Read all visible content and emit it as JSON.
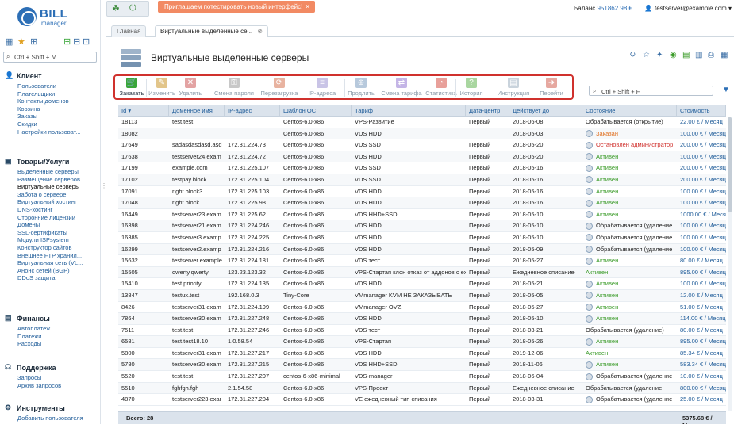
{
  "app": {
    "logo_bill": "BILL",
    "logo_manager": "manager"
  },
  "sidebar": {
    "search_placeholder": "Ctrl + Shift + M",
    "groups": [
      {
        "title": "Клиент",
        "icon": "user-icon",
        "items": [
          "Пользователи",
          "Плательщики",
          "Контакты доменов",
          "Корзина",
          "Заказы",
          "Скидки",
          "Настройки пользоват..."
        ]
      },
      {
        "title": "Товары/Услуги",
        "icon": "box-icon",
        "items": [
          "Выделенные серверы",
          "Размещение серверов",
          "Виртуальные серверы",
          "Забота о сервере",
          "Виртуальный хостинг",
          "DNS-хостинг",
          "Сторонние лицензии",
          "Домены",
          "SSL-сертификаты",
          "Модули ISPsystem",
          "Конструктор сайтов",
          "Внешнее FTP хранил...",
          "Виртуальная сеть (VL...",
          "Анонс сетей (BGP)",
          "DDoS защита"
        ]
      },
      {
        "title": "Финансы",
        "icon": "wallet-icon",
        "items": [
          "Автоплатеж",
          "Платежи",
          "Расходы"
        ]
      },
      {
        "title": "Поддержка",
        "icon": "headset-icon",
        "items": [
          "Запросы",
          "Архив запросов"
        ]
      },
      {
        "title": "Инструменты",
        "icon": "tools-icon",
        "items": [
          "Добавить пользователя"
        ]
      }
    ],
    "active_item": "Виртуальные серверы"
  },
  "header": {
    "promo_text": "Приглашаем потестировать новый интерфейс!",
    "balance_label": "Баланс",
    "balance_value": "951862.98 €",
    "user": "testserver@example.com"
  },
  "tabs": [
    {
      "label": "Главная",
      "active": false
    },
    {
      "label": "Виртуальные выделенные се...",
      "active": true
    }
  ],
  "page": {
    "title": "Виртуальные выделенные серверы"
  },
  "toolbar": {
    "buttons": [
      {
        "label": "Заказать",
        "icon": "order-icon",
        "enabled": true,
        "color": "#3aa63a"
      },
      {
        "label": "Изменить",
        "icon": "edit-icon",
        "enabled": false,
        "color": "#e2c58a"
      },
      {
        "label": "Удалить",
        "icon": "delete-icon",
        "enabled": false,
        "color": "#e3a3a3"
      },
      {
        "label": "Смена пароля",
        "icon": "key-icon",
        "enabled": false,
        "color": "#c8c8c8"
      },
      {
        "label": "Перезагрузка",
        "icon": "reboot-icon",
        "enabled": false,
        "color": "#e8b3a0"
      },
      {
        "label": "IP-адреса",
        "icon": "ip-icon",
        "enabled": false,
        "color": "#c9c4e6"
      },
      {
        "label": "Продлить",
        "icon": "prolong-icon",
        "enabled": false,
        "color": "#b7c9dc"
      },
      {
        "label": "Смена тарифа",
        "icon": "tariff-icon",
        "enabled": false,
        "color": "#c4b5e6"
      },
      {
        "label": "Статистика",
        "icon": "stats-icon",
        "enabled": false,
        "color": "#e8a09a"
      },
      {
        "label": "История",
        "icon": "history-icon",
        "enabled": false,
        "color": "#a9d6a0"
      },
      {
        "label": "Инструкция",
        "icon": "instruction-icon",
        "enabled": false,
        "color": "#c9d3dc"
      },
      {
        "label": "Перейти",
        "icon": "goto-icon",
        "enabled": false,
        "color": "#e6a8a0"
      }
    ]
  },
  "filter": {
    "placeholder": "Ctrl + Shift + F"
  },
  "table": {
    "columns": [
      "Id",
      "Доменное имя",
      "IP-адрес",
      "Шаблон ОС",
      "Тариф",
      "Дата-центр",
      "Действует до",
      "Состояние",
      "Стоимость"
    ],
    "rows": [
      {
        "id": "18113",
        "domain": "test.test",
        "ip": "",
        "os": "Centos-6.0-x86",
        "tariff": "VPS-Развитие",
        "dc": "Первый",
        "until": "2018-06-08",
        "state": "Обрабатывается (открытие)",
        "state_type": "processing",
        "icon": false,
        "cost": "22.00 € / Месяц"
      },
      {
        "id": "18082",
        "domain": "",
        "ip": "",
        "os": "Centos-6.0-x86",
        "tariff": "VDS HDD",
        "dc": "",
        "until": "2018-05-03",
        "state": "Заказан",
        "state_type": "ordered",
        "icon": true,
        "cost": "100.00 € / Месяц"
      },
      {
        "id": "17649",
        "domain": "sadasdasdasd.asd",
        "ip": "172.31.224.73",
        "os": "Centos-6.0-x86",
        "tariff": "VDS SSD",
        "dc": "Первый",
        "until": "2018-05-20",
        "state": "Остановлен администратор",
        "state_type": "stopped",
        "icon": true,
        "cost": "200.00 € / Месяц"
      },
      {
        "id": "17638",
        "domain": "testserver24.exam",
        "ip": "172.31.224.72",
        "os": "Centos-6.0-x86",
        "tariff": "VDS HDD",
        "dc": "Первый",
        "until": "2018-05-20",
        "state": "Активен",
        "state_type": "active",
        "icon": true,
        "cost": "100.00 € / Месяц"
      },
      {
        "id": "17199",
        "domain": "example.com",
        "ip": "172.31.225.107",
        "os": "Centos-6.0-x86",
        "tariff": "VDS SSD",
        "dc": "Первый",
        "until": "2018-05-16",
        "state": "Активен",
        "state_type": "active",
        "icon": true,
        "cost": "200.00 € / Месяц"
      },
      {
        "id": "17102",
        "domain": "testpay.block",
        "ip": "172.31.225.104",
        "os": "Centos-6.0-x86",
        "tariff": "VDS SSD",
        "dc": "Первый",
        "until": "2018-05-16",
        "state": "Активен",
        "state_type": "active",
        "icon": true,
        "cost": "200.00 € / Месяц"
      },
      {
        "id": "17091",
        "domain": "right.block3",
        "ip": "172.31.225.103",
        "os": "Centos-6.0-x86",
        "tariff": "VDS HDD",
        "dc": "Первый",
        "until": "2018-05-16",
        "state": "Активен",
        "state_type": "active",
        "icon": true,
        "cost": "100.00 € / Месяц"
      },
      {
        "id": "17048",
        "domain": "right.block",
        "ip": "172.31.225.98",
        "os": "Centos-6.0-x86",
        "tariff": "VDS HDD",
        "dc": "Первый",
        "until": "2018-05-16",
        "state": "Активен",
        "state_type": "active",
        "icon": true,
        "cost": "100.00 € / Месяц"
      },
      {
        "id": "16449",
        "domain": "testserver23.exam",
        "ip": "172.31.225.62",
        "os": "Centos-6.0-x86",
        "tariff": "VDS HHD+SSD",
        "dc": "Первый",
        "until": "2018-05-10",
        "state": "Активен",
        "state_type": "active",
        "icon": true,
        "cost": "1000.00 € / Месяц"
      },
      {
        "id": "16398",
        "domain": "testserver21.exam",
        "ip": "172.31.224.246",
        "os": "Centos-6.0-x86",
        "tariff": "VDS HDD",
        "dc": "Первый",
        "until": "2018-05-10",
        "state": "Обрабатывается (удаление",
        "state_type": "processing",
        "icon": true,
        "cost": "100.00 € / Месяц"
      },
      {
        "id": "16385",
        "domain": "testserver3.examp",
        "ip": "172.31.224.225",
        "os": "Centos-6.0-x86",
        "tariff": "VDS HDD",
        "dc": "Первый",
        "until": "2018-05-10",
        "state": "Обрабатывается (удаление",
        "state_type": "processing",
        "icon": true,
        "cost": "100.00 € / Месяц"
      },
      {
        "id": "16299",
        "domain": "testserver2.examp",
        "ip": "172.31.224.216",
        "os": "Centos-6.0-x86",
        "tariff": "VDS HDD",
        "dc": "Первый",
        "until": "2018-05-09",
        "state": "Обрабатывается (удаление",
        "state_type": "processing",
        "icon": true,
        "cost": "100.00 € / Месяц"
      },
      {
        "id": "15632",
        "domain": "testserver.example",
        "ip": "172.31.224.181",
        "os": "Centos-6.0-x86",
        "tariff": "VDS тест",
        "dc": "Первый",
        "until": "2018-05-27",
        "state": "Активен",
        "state_type": "active",
        "icon": true,
        "cost": "80.00 € / Месяц"
      },
      {
        "id": "15505",
        "domain": "qwerty.qwerty",
        "ip": "123.23.123.32",
        "os": "Centos-6.0-x86",
        "tariff": "VPS-Стартап клон отказ от аддонов с ex",
        "dc": "Первый",
        "until": "Ежедневное списание",
        "state": "Активен",
        "state_type": "active",
        "icon": false,
        "cost": "895.00 € / Месяц"
      },
      {
        "id": "15410",
        "domain": "test.priority",
        "ip": "172.31.224.135",
        "os": "Centos-6.0-x86",
        "tariff": "VDS HDD",
        "dc": "Первый",
        "until": "2018-05-21",
        "state": "Активен",
        "state_type": "active",
        "icon": true,
        "cost": "100.00 € / Месяц"
      },
      {
        "id": "13847",
        "domain": "testux.test",
        "ip": "192.168.0.3",
        "os": "Tiny-Core",
        "tariff": "VMmanager KVM НЕ ЗАКАЗЫВАТЬ",
        "dc": "Первый",
        "until": "2018-05-05",
        "state": "Активен",
        "state_type": "active",
        "icon": true,
        "cost": "12.00 € / Месяц"
      },
      {
        "id": "8426",
        "domain": "testserver31.exam",
        "ip": "172.31.224.199",
        "os": "Centos-6.0-x86",
        "tariff": "VMmanager OVZ",
        "dc": "Первый",
        "until": "2018-05-27",
        "state": "Активен",
        "state_type": "active",
        "icon": true,
        "cost": "51.00 € / Месяц"
      },
      {
        "id": "7864",
        "domain": "testserver30.exam",
        "ip": "172.31.227.248",
        "os": "Centos-6.0-x86",
        "tariff": "VDS HDD",
        "dc": "Первый",
        "until": "2018-05-10",
        "state": "Активен",
        "state_type": "active",
        "icon": true,
        "cost": "114.00 € / Месяц"
      },
      {
        "id": "7511",
        "domain": "test.test",
        "ip": "172.31.227.246",
        "os": "Centos-6.0-x86",
        "tariff": "VDS тест",
        "dc": "Первый",
        "until": "2018-03-21",
        "state": "Обрабатывается (удаление)",
        "state_type": "processing",
        "icon": false,
        "cost": "80.00 € / Месяц"
      },
      {
        "id": "6581",
        "domain": "test.test18.10",
        "ip": "1.0.58.54",
        "os": "Centos-6.0-x86",
        "tariff": "VPS-Стартап",
        "dc": "Первый",
        "until": "2018-05-26",
        "state": "Активен",
        "state_type": "active",
        "icon": true,
        "cost": "895.00 € / Месяц"
      },
      {
        "id": "5800",
        "domain": "testserver31.exam",
        "ip": "172.31.227.217",
        "os": "Centos-6.0-x86",
        "tariff": "VDS HDD",
        "dc": "Первый",
        "until": "2019-12-06",
        "state": "Активен",
        "state_type": "active",
        "icon": false,
        "cost": "85.34 € / Месяц"
      },
      {
        "id": "5780",
        "domain": "testserver30.exam",
        "ip": "172.31.227.215",
        "os": "Centos-6.0-x86",
        "tariff": "VDS HHD+SSD",
        "dc": "Первый",
        "until": "2018-11-06",
        "state": "Активен",
        "state_type": "active",
        "icon": true,
        "cost": "583.34 € / Месяц"
      },
      {
        "id": "5520",
        "domain": "test.test",
        "ip": "172.31.227.207",
        "os": "centos-6-x86-minimal",
        "tariff": "VDS-manager",
        "dc": "Первый",
        "until": "2018-06-04",
        "state": "Обрабатывается (удаление",
        "state_type": "processing",
        "icon": true,
        "cost": "10.00 € / Месяц"
      },
      {
        "id": "5510",
        "domain": "fghfgh.fgh",
        "ip": "2.1.54.58",
        "os": "Centos-6.0-x86",
        "tariff": "VPS-Проект",
        "dc": "Первый",
        "until": "Ежедневное списание",
        "state": "Обрабатывается (удаление",
        "state_type": "processing",
        "icon": false,
        "cost": "800.00 € / Месяц"
      },
      {
        "id": "4870",
        "domain": "testserver223.exar",
        "ip": "172.31.227.204",
        "os": "Centos-6.0-x86",
        "tariff": "VE ежедневный тип списания",
        "dc": "Первый",
        "until": "2018-03-31",
        "state": "Обрабатывается (удаление",
        "state_type": "processing",
        "icon": true,
        "cost": "25.00 € / Месяц"
      }
    ],
    "footer_total": "Всего: 28",
    "footer_sum": "5375.68 € / Месяц"
  },
  "colors": {
    "accent": "#2d6fb6",
    "active": "#3a9b28",
    "stopped": "#d0312d",
    "ordered": "#e07020",
    "highlight_border": "#d0312d"
  }
}
